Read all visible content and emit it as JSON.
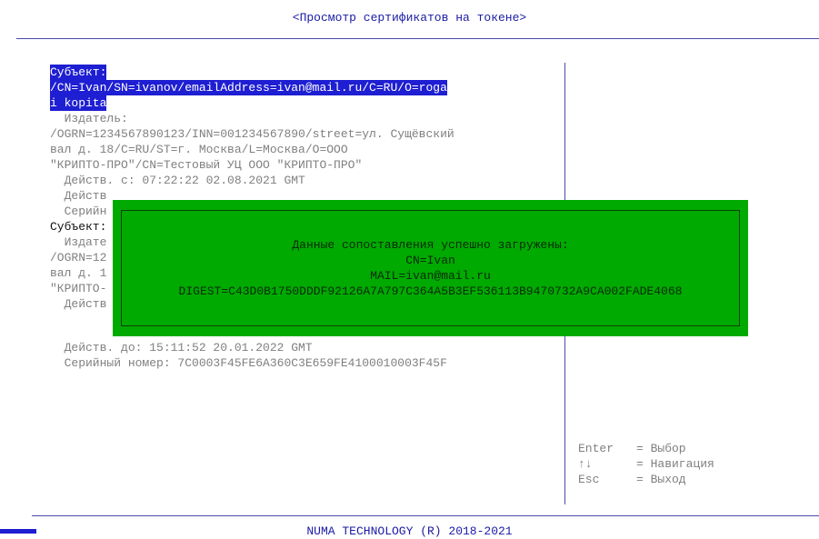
{
  "title": "<Просмотр сертификатов на токене>",
  "certificates": {
    "lines": [
      "Субъект:",
      "/CN=Ivan/SN=ivanov/emailAddress=ivan@mail.ru/C=RU/O=roga",
      "i kopita",
      "  Издатель:",
      "/OGRN=1234567890123/INN=001234567890/street=ул. Сущёвский",
      "вал д. 18/C=RU/ST=г. Москва/L=Москва/O=ООО",
      "\"КРИПТО-ПРО\"/CN=Тестовый УЦ ООО \"КРИПТО-ПРО\"",
      "  Действ. с: 07:22:22 02.08.2021 GMT",
      "  Действ",
      "  Серийн",
      "Субъект:",
      "  Издате",
      "/OGRN=12",
      "вал д. 1",
      "\"КРИПТО-",
      "  Действ",
      "  Действ. до: 15:11:52 20.01.2022 GMT",
      "  Серийный номер: 7C0003F45FE6A360C3E659FE4100010003F45F"
    ]
  },
  "dialog": {
    "lines": [
      "Данные сопоставления успешно загружены:",
      "CN=Ivan",
      "MAIL=ivan@mail.ru",
      "DIGEST=C43D0B1750DDDF92126A7A797C364A5B3EF536113B9470732A9CA002FADE4068"
    ]
  },
  "help": {
    "enter_key": "Enter",
    "enter_action": "= Выбор",
    "nav_key": "↑↓",
    "nav_action": "= Навигация",
    "esc_key": "Esc",
    "esc_action": "= Выход"
  },
  "footer": "NUMA TECHNOLOGY (R) 2018-2021",
  "colors": {
    "selection": "#1e1ed2",
    "dialog_bg": "#00aa00",
    "frame_lines": "#4a4aa8"
  }
}
